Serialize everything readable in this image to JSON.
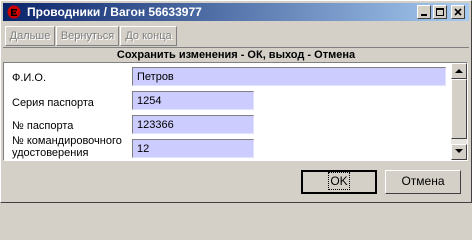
{
  "window": {
    "title": "Проводники / Вагон 56633977",
    "controls": [
      "minimize-icon",
      "maximize-icon",
      "close-icon"
    ]
  },
  "toolbar": {
    "next_label": "Дальше",
    "back_label": "Вернуться",
    "end_label": "До конца"
  },
  "form": {
    "header": "Сохранить изменения - ОК, выход - Отмена",
    "fields": [
      {
        "label": "Ф.И.О.",
        "value": "Петров"
      },
      {
        "label": "Серия паспорта",
        "value": "1254"
      },
      {
        "label": "№ паспорта",
        "value": "123366"
      },
      {
        "label_line1": "№ командировочного",
        "label_line2": "удостоверения",
        "value": "12"
      }
    ]
  },
  "buttons": {
    "ok_label": "OK",
    "cancel_label": "Отмена"
  },
  "colors": {
    "titlebar_start": "#0a246a",
    "titlebar_end": "#a6caf0",
    "field_bg": "#ccccff",
    "window_bg": "#d4d0c8"
  }
}
